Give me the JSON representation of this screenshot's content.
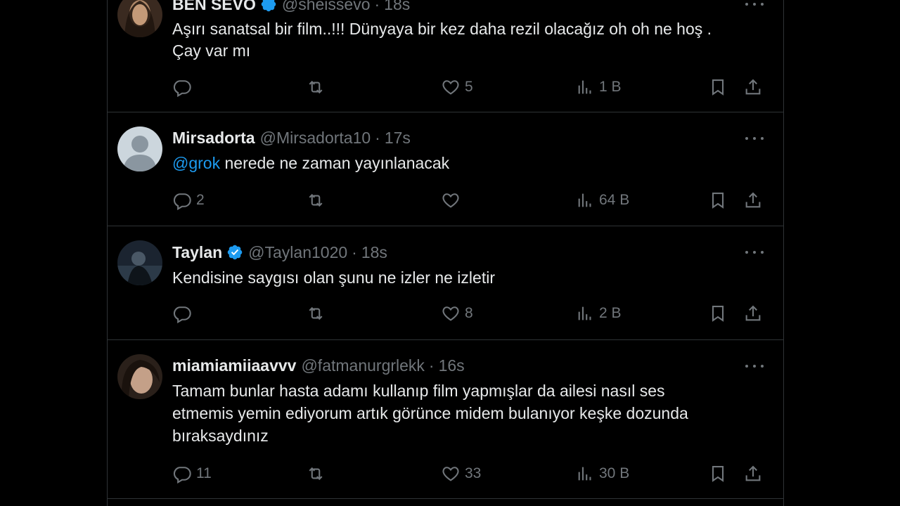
{
  "tweets": [
    {
      "name": "BEN SEVO",
      "verified": true,
      "verified_color": "#1d9bf0",
      "handle": "@sheissevo",
      "time": "18s",
      "text": "Aşırı sanatsal bir film..!!! Dünyaya bir kez daha rezil olacağız oh oh ne hoş .\nÇay var mı",
      "replies": "",
      "retweets": "",
      "likes": "5",
      "views": "1 B"
    },
    {
      "name": "Mirsadorta",
      "verified": false,
      "handle": "@Mirsadorta10",
      "time": "17s",
      "mention": "@grok",
      "text": " nerede ne zaman yayınlanacak",
      "replies": "2",
      "retweets": "",
      "likes": "",
      "views": "64 B"
    },
    {
      "name": "Taylan",
      "verified": true,
      "verified_color": "#1d9bf0",
      "handle": "@Taylan1020",
      "time": "18s",
      "text": "Kendisine saygısı olan şunu ne izler ne izletir",
      "replies": "",
      "retweets": "",
      "likes": "8",
      "views": "2 B"
    },
    {
      "name": "miamiamiiaavvv",
      "verified": false,
      "handle": "@fatmanurgrlekk",
      "time": "16s",
      "text": "Tamam bunlar hasta adamı kullanıp film yapmışlar da ailesi nasıl ses\netmemis yemin ediyorum artık görünce midem bulanıyor keşke dozunda\nbıraksaydınız",
      "replies": "11",
      "retweets": "",
      "likes": "33",
      "views": "30 B"
    }
  ],
  "colors": {
    "background": "#000000",
    "text": "#e7e9ea",
    "muted": "#71767b",
    "border": "#2f3336",
    "accent": "#1d9bf0"
  },
  "icons": [
    "reply-icon",
    "retweet-icon",
    "like-icon",
    "views-icon",
    "bookmark-icon",
    "share-icon",
    "more-icon",
    "verified-icon"
  ]
}
